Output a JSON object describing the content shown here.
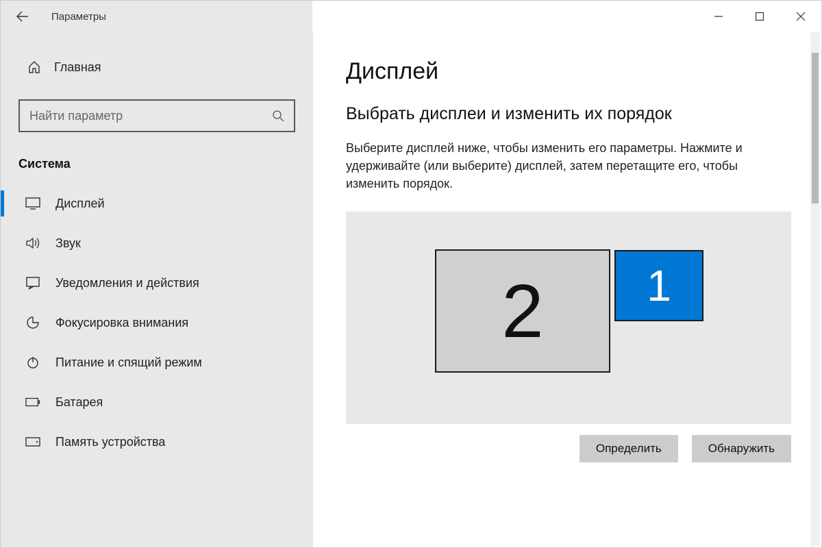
{
  "window": {
    "title": "Параметры"
  },
  "sidebar": {
    "home_label": "Главная",
    "search_placeholder": "Найти параметр",
    "category_label": "Система",
    "items": [
      {
        "label": "Дисплей",
        "icon": "display-icon",
        "selected": true
      },
      {
        "label": "Звук",
        "icon": "sound-icon",
        "selected": false
      },
      {
        "label": "Уведомления и действия",
        "icon": "notifications-icon",
        "selected": false
      },
      {
        "label": "Фокусировка внимания",
        "icon": "focus-icon",
        "selected": false
      },
      {
        "label": "Питание и спящий режим",
        "icon": "power-icon",
        "selected": false
      },
      {
        "label": "Батарея",
        "icon": "battery-icon",
        "selected": false
      },
      {
        "label": "Память устройства",
        "icon": "storage-icon",
        "selected": false
      }
    ]
  },
  "content": {
    "page_title": "Дисплей",
    "section_title": "Выбрать дисплеи и изменить их порядок",
    "section_desc": "Выберите дисплей ниже, чтобы изменить его параметры. Нажмите и удерживайте (или выберите) дисплей, затем перетащите его, чтобы изменить порядок.",
    "monitors": {
      "monitor1_label": "1",
      "monitor2_label": "2"
    },
    "identify_btn": "Определить",
    "detect_btn": "Обнаружить"
  }
}
